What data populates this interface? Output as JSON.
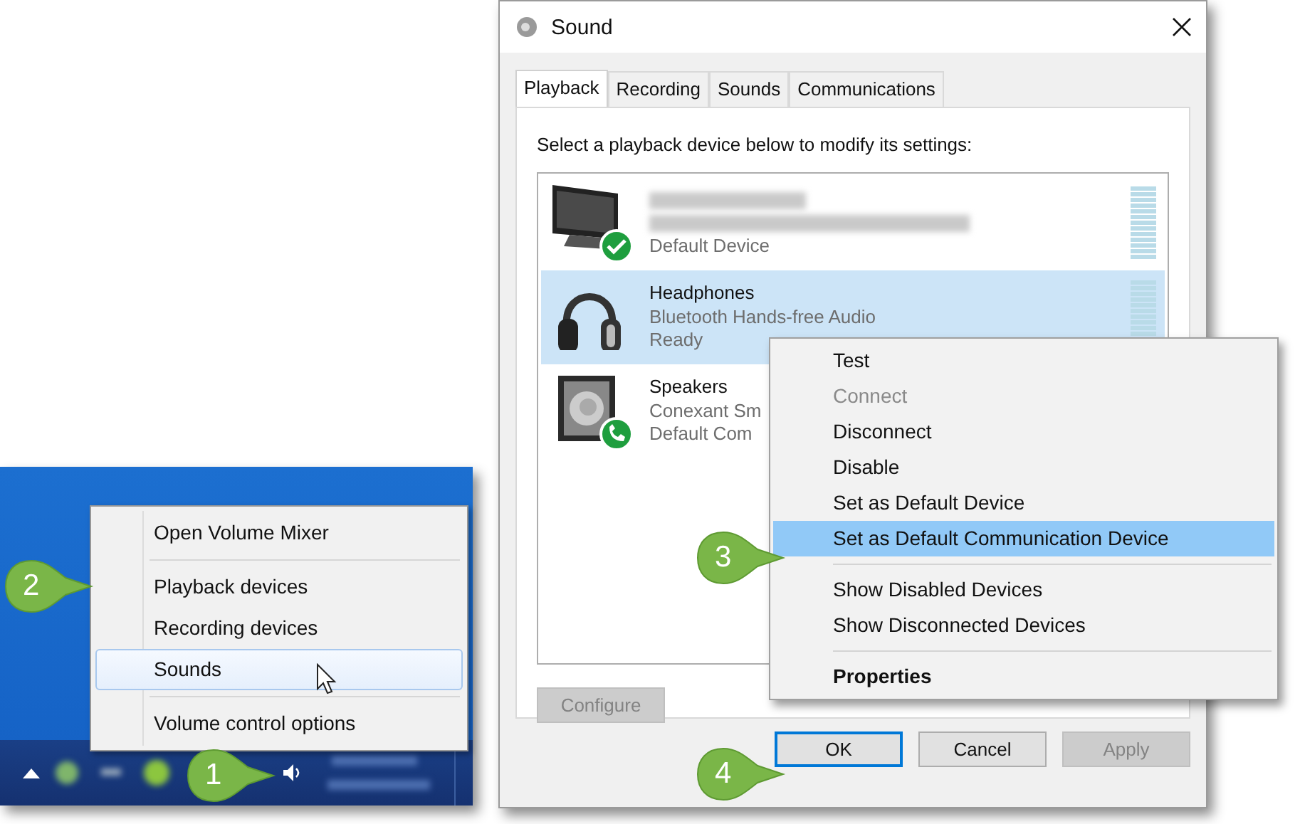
{
  "tray_menu": {
    "groups": [
      [
        {
          "label": "Open Volume Mixer",
          "selected": false
        }
      ],
      [
        {
          "label": "Playback devices",
          "selected": false
        },
        {
          "label": "Recording devices",
          "selected": false
        },
        {
          "label": "Sounds",
          "selected": true
        }
      ],
      [
        {
          "label": "Volume control options",
          "selected": false
        }
      ]
    ]
  },
  "dialog": {
    "title": "Sound",
    "tabs": [
      {
        "label": "Playback",
        "selected": true
      },
      {
        "label": "Recording",
        "selected": false
      },
      {
        "label": "Sounds",
        "selected": false
      },
      {
        "label": "Communications",
        "selected": false
      }
    ],
    "instruction": "Select a playback device below to modify its settings:",
    "devices": [
      {
        "kind": "monitor",
        "badge": {
          "kind": "check"
        },
        "meter": true,
        "status": "Default Device",
        "selected": false
      },
      {
        "kind": "headphones",
        "meter": true,
        "name": "Headphones",
        "description": "Bluetooth Hands-free Audio",
        "status": "Ready",
        "selected": true
      },
      {
        "kind": "speaker",
        "badge": {
          "kind": "phone"
        },
        "name": "Speakers",
        "description": "Conexant Sm",
        "status": "Default Com",
        "selected": false
      }
    ],
    "configure_button": {
      "label": "Configure",
      "disabled": true
    },
    "buttons": [
      {
        "label": "OK",
        "default": true,
        "disabled": false
      },
      {
        "label": "Cancel",
        "default": false,
        "disabled": false
      },
      {
        "label": "Apply",
        "default": false,
        "disabled": true
      }
    ]
  },
  "context_menu": {
    "groups": [
      [
        {
          "label": "Test",
          "disabled": false,
          "selected": false,
          "default": false
        },
        {
          "label": "Connect",
          "disabled": true,
          "selected": false,
          "default": false
        },
        {
          "label": "Disconnect",
          "disabled": false,
          "selected": false,
          "default": false
        },
        {
          "label": "Disable",
          "disabled": false,
          "selected": false,
          "default": false
        },
        {
          "label": "Set as Default Device",
          "disabled": false,
          "selected": false,
          "default": false
        },
        {
          "label": "Set as Default Communication Device",
          "disabled": false,
          "selected": true,
          "default": false
        }
      ],
      [
        {
          "label": "Show Disabled Devices",
          "disabled": false,
          "selected": false,
          "default": false
        },
        {
          "label": "Show Disconnected Devices",
          "disabled": false,
          "selected": false,
          "default": false
        }
      ],
      [
        {
          "label": "Properties",
          "disabled": false,
          "selected": false,
          "default": true
        }
      ]
    ]
  },
  "callouts": [
    {
      "number": "1"
    },
    {
      "number": "2"
    },
    {
      "number": "3"
    },
    {
      "number": "4"
    }
  ]
}
